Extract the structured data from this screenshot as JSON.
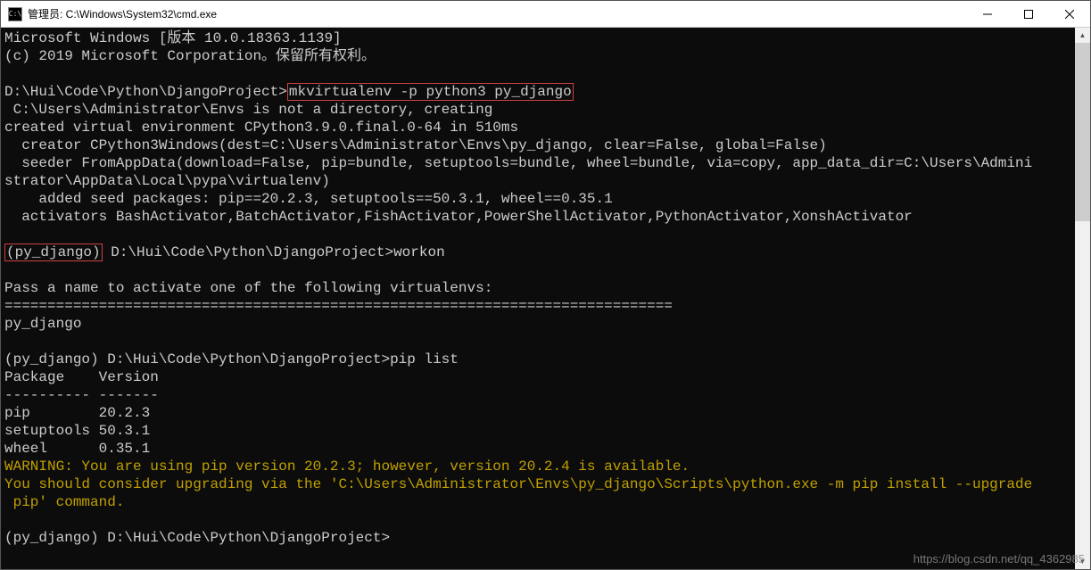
{
  "window": {
    "icon_label": "C:\\",
    "title": "管理员: C:\\Windows\\System32\\cmd.exe"
  },
  "terminal": {
    "header1": "Microsoft Windows [版本 10.0.18363.1139]",
    "header2": "(c) 2019 Microsoft Corporation。保留所有权利。",
    "prompt1": "D:\\Hui\\Code\\Python\\DjangoProject>",
    "cmd1": "mkvirtualenv -p python3 py_django",
    "out1": " C:\\Users\\Administrator\\Envs is not a directory, creating",
    "out2": "created virtual environment CPython3.9.0.final.0-64 in 510ms",
    "out3": "  creator CPython3Windows(dest=C:\\Users\\Administrator\\Envs\\py_django, clear=False, global=False)",
    "out4a": "  seeder FromAppData(download=False, pip=bundle, setuptools=bundle, wheel=bundle, via=copy, app_data_dir=C:\\Users\\Admini",
    "out4b": "strator\\AppData\\Local\\pypa\\virtualenv)",
    "out5": "    added seed packages: pip==20.2.3, setuptools==50.3.1, wheel==0.35.1",
    "out6": "  activators BashActivator,BatchActivator,FishActivator,PowerShellActivator,PythonActivator,XonshActivator",
    "env": "(py_django)",
    "prompt2_rest": " D:\\Hui\\Code\\Python\\DjangoProject>workon",
    "workon_msg": "Pass a name to activate one of the following virtualenvs:",
    "workon_sep": "==============================================================================",
    "workon_env": "py_django",
    "prompt3": "(py_django) D:\\Hui\\Code\\Python\\DjangoProject>pip list",
    "pip_header": "Package    Version",
    "pip_sep": "---------- -------",
    "pip_rows": [
      "pip        20.2.3",
      "setuptools 50.3.1",
      "wheel      0.35.1"
    ],
    "warn1": "WARNING: You are using pip version 20.2.3; however, version 20.2.4 is available.",
    "warn2": "You should consider upgrading via the 'C:\\Users\\Administrator\\Envs\\py_django\\Scripts\\python.exe -m pip install --upgrade",
    "warn3": " pip' command.",
    "prompt4": "(py_django) D:\\Hui\\Code\\Python\\DjangoProject>"
  },
  "watermark": "https://blog.csdn.net/qq_4362985"
}
